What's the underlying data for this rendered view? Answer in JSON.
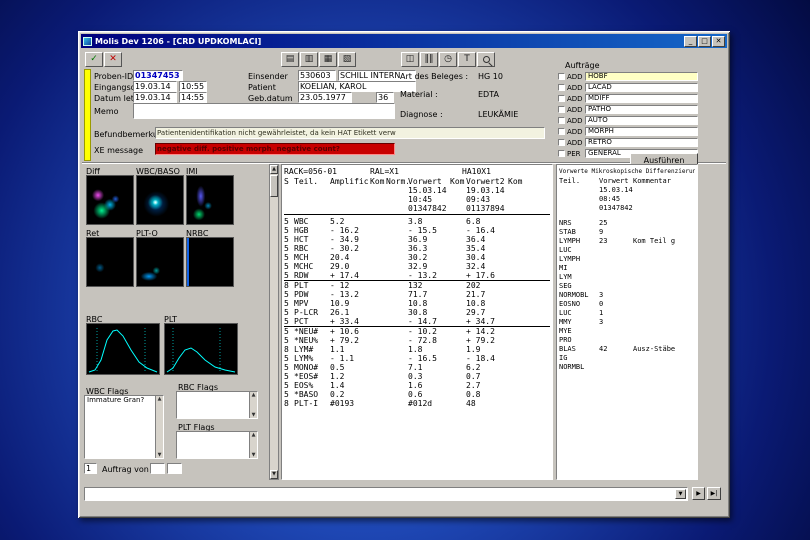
{
  "window": {
    "title": "Molis Dev 1206 - [CRD UPDKOMLACI]",
    "min_glyph": "_",
    "max_glyph": "□",
    "close_glyph": "✕"
  },
  "toolbar": {
    "buttons": [
      {
        "name": "confirm-icon",
        "glyph": "✓"
      },
      {
        "name": "cancel-icon",
        "glyph": "✕"
      },
      {
        "name": "print-icon",
        "glyph": "▤"
      },
      {
        "name": "print-preview-icon",
        "glyph": "▥"
      },
      {
        "name": "print-list-icon",
        "glyph": "▦"
      },
      {
        "name": "export-icon",
        "glyph": "▧"
      },
      {
        "name": "grid-view-icon",
        "glyph": "◫"
      },
      {
        "name": "barcode-icon",
        "glyph": "‖‖"
      },
      {
        "name": "history-clock-icon",
        "glyph": "◷"
      },
      {
        "name": "text-tool-icon",
        "glyph": "T"
      },
      {
        "name": "search-icon",
        "glyph": ""
      }
    ]
  },
  "sample": {
    "proben_label": "Proben-ID",
    "proben_id": "01347453",
    "eingang_label": "Eingangsdatum",
    "eingang_date": "19.03.14",
    "eingang_time": "10:55",
    "letzter_label": "Datum letzter",
    "letzter_date": "19.03.14",
    "letzter_time": "14:55",
    "einsender_label": "Einsender",
    "einsender_code": "530603",
    "einsender_name": "SCHILL INTERN",
    "patient_label": "Patient",
    "patient_name": "KOELIAN, KAROL",
    "geb_label": "Geb.datum",
    "geb_date": "23.05.1977",
    "alter": "36",
    "memo_label": "Memo",
    "memo": "",
    "befund_label": "Befundbemerkung",
    "befund_text": "Patientenidentifikation nicht gewährleistet, da kein HAT Etikett verw",
    "xe_label": "XE message",
    "xe_text": "negative diff.   positive morph.   negative count?"
  },
  "beleg": {
    "art_label": "Art des Beleges :",
    "art_value": "HG 10",
    "material_label": "Material :",
    "material_value": "EDTA",
    "diagnose_label": "Diagnose :",
    "diagnose_value": "LEUKÄMIE"
  },
  "auftraege": {
    "title": "Aufträge",
    "items": [
      {
        "type": "ADD",
        "name": "HOBF",
        "cls": "hl"
      },
      {
        "type": "ADD",
        "name": "LACAD"
      },
      {
        "type": "ADD",
        "name": "MDIFF"
      },
      {
        "type": "ADD",
        "name": "PATHO"
      },
      {
        "type": "ADD",
        "name": "AUTO"
      },
      {
        "type": "ADD",
        "name": "MORPH"
      },
      {
        "type": "ADD",
        "name": "RETRO"
      },
      {
        "type": "PER",
        "name": "GENERAL"
      }
    ],
    "execute_label": "Ausführen"
  },
  "plots": {
    "row1": [
      "Diff",
      "WBC/BASO",
      "IMI"
    ],
    "row2": [
      "Ret",
      "PLT-O",
      "NRBC"
    ],
    "hist": [
      "RBC",
      "PLT"
    ]
  },
  "flags": {
    "wbc_label": "WBC Flags",
    "wbc_items": [
      "Immature Gran?"
    ],
    "rbc_label": "RBC Flags",
    "rbc_items": [],
    "plt_label": "PLT Flags",
    "plt_items": []
  },
  "order_nav": {
    "count": "1",
    "label": "Auftrag von",
    "from": "",
    "to": ""
  },
  "results": {
    "rack": "RACK=056-01",
    "ral": "RAL=X1",
    "device": "HA10X1",
    "headers": [
      "S",
      "Teil.",
      "Amplific",
      "Kom",
      "Norm.",
      "Vorwert",
      "Kom",
      "Vorwert2",
      "Kom"
    ],
    "vorwert_date": "15.03.14",
    "vorwert2_date": "19.03.14",
    "vorwert_time": "10:45",
    "vorwert2_time": "09:43",
    "vorwert_id": "01347842",
    "vorwert2_id": "01137894",
    "rows": [
      {
        "s": "5",
        "name": "WBC",
        "val": "5.2",
        "vw": "3.8",
        "vw2": "6.8"
      },
      {
        "s": "5",
        "name": "HGB",
        "val": "- 16.2",
        "vw": "- 15.5",
        "vw2": "- 16.4"
      },
      {
        "s": "5",
        "name": "HCT",
        "val": "- 34.9",
        "vw": "36.9",
        "vw2": "36.4"
      },
      {
        "s": "5",
        "name": "RBC",
        "val": "- 30.2",
        "vw": "36.3",
        "vw2": "35.4"
      },
      {
        "s": "5",
        "name": "MCH",
        "val": "20.4",
        "vw": "30.2",
        "vw2": "30.4"
      },
      {
        "s": "5",
        "name": "MCHC",
        "val": "29.0",
        "vw": "32.9",
        "vw2": "32.4"
      },
      {
        "s": "5",
        "name": "RDW",
        "val": "+ 17.4",
        "vw": "- 13.2",
        "vw2": "+ 17.6",
        "cls": "sep"
      },
      {
        "s": "8",
        "name": "PLT",
        "val": "- 12",
        "vw": "132",
        "vw2": "202"
      },
      {
        "s": "5",
        "name": "PDW",
        "val": "- 13.2",
        "vw": "71.7",
        "vw2": "21.7"
      },
      {
        "s": "5",
        "name": "MPV",
        "val": "10.9",
        "vw": "10.8",
        "vw2": "10.8"
      },
      {
        "s": "5",
        "name": "P-LCR",
        "val": "26.1",
        "vw": "30.8",
        "vw2": "29.7"
      },
      {
        "s": "5",
        "name": "PCT",
        "val": "+ 33.4",
        "vw": "- 14.7",
        "vw2": "+ 34.7",
        "cls": "sep"
      },
      {
        "s": "5",
        "name": "*NEU#",
        "val": "+ 10.6",
        "vw": "- 10.2",
        "vw2": "+ 14.2"
      },
      {
        "s": "5",
        "name": "*NEU%",
        "val": "+ 79.2",
        "vw": "- 72.8",
        "vw2": "+ 79.2"
      },
      {
        "s": "8",
        "name": "LYM#",
        "val": "1.1",
        "vw": "1.8",
        "vw2": "1.9"
      },
      {
        "s": "5",
        "name": "LYM%",
        "val": "- 1.1",
        "vw": "- 16.5",
        "vw2": "- 18.4"
      },
      {
        "s": "5",
        "name": "MONO#",
        "val": "0.5",
        "vw": "7.1",
        "vw2": "6.2"
      },
      {
        "s": "5",
        "name": "*EOS#",
        "val": "1.2",
        "vw": "0.3",
        "vw2": "0.7"
      },
      {
        "s": "5",
        "name": "EOS%",
        "val": "1.4",
        "vw": "1.6",
        "vw2": "2.7"
      },
      {
        "s": "5",
        "name": "*BASO",
        "val": "0.2",
        "vw": "0.6",
        "vw2": "0.8"
      },
      {
        "s": "8",
        "name": "PLT-I",
        "val": "#0193",
        "vw": "#012d",
        "vw2": "48"
      }
    ]
  },
  "micro": {
    "title": "Vorwerte Mikroskopische Differenzierung",
    "headers": [
      "Teil.",
      "Vorwert",
      "Kommentar"
    ],
    "date": "15.03.14",
    "time": "08:45",
    "id": "01347842",
    "rows": [
      {
        "name": "NRS",
        "value": "25",
        "comment": ""
      },
      {
        "name": "STAB",
        "value": "9",
        "comment": ""
      },
      {
        "name": "LYMPH",
        "value": "23",
        "comment": "Kom Teil g"
      },
      {
        "name": "LUC",
        "value": "",
        "comment": ""
      },
      {
        "name": "LYMPH",
        "value": "",
        "comment": ""
      },
      {
        "name": "MI",
        "value": "",
        "comment": ""
      },
      {
        "name": "LYM",
        "value": "",
        "comment": ""
      },
      {
        "name": "SEG",
        "value": "",
        "comment": ""
      },
      {
        "name": "NORMOBL",
        "value": "3",
        "comment": ""
      },
      {
        "name": "EOSNO",
        "value": "0",
        "comment": ""
      },
      {
        "name": "LUC",
        "value": "1",
        "comment": ""
      },
      {
        "name": "MMY",
        "value": "3",
        "comment": ""
      },
      {
        "name": "MYE",
        "value": "",
        "comment": ""
      },
      {
        "name": "PRO",
        "value": "",
        "comment": ""
      },
      {
        "name": "BLAS",
        "value": "42",
        "comment": "Ausz-Stäbe"
      },
      {
        "name": "IG",
        "value": "",
        "comment": ""
      },
      {
        "name": "NORMBL",
        "value": "",
        "comment": ""
      }
    ]
  },
  "command": {
    "value": "",
    "arrow_glyph": "▼",
    "next_glyph": "▶",
    "last_glyph": "▶|"
  },
  "colors": {
    "titlebar_start": "#00007c",
    "titlebar_end": "#1567c8",
    "desktop_center": "#2f6bdc",
    "desktop_edge": "#030b42",
    "xe_bg": "#c80000",
    "xe_text": "#5a0000",
    "stripe_yellow": "#ffff00",
    "highlight_row": "#ffffc4",
    "proben_text": "#0000c0",
    "scatter_cyan": "#00ffff",
    "scatter_green": "#00ff90",
    "scatter_magenta": "#ff50ff",
    "scatter_blue": "#2060ff"
  }
}
